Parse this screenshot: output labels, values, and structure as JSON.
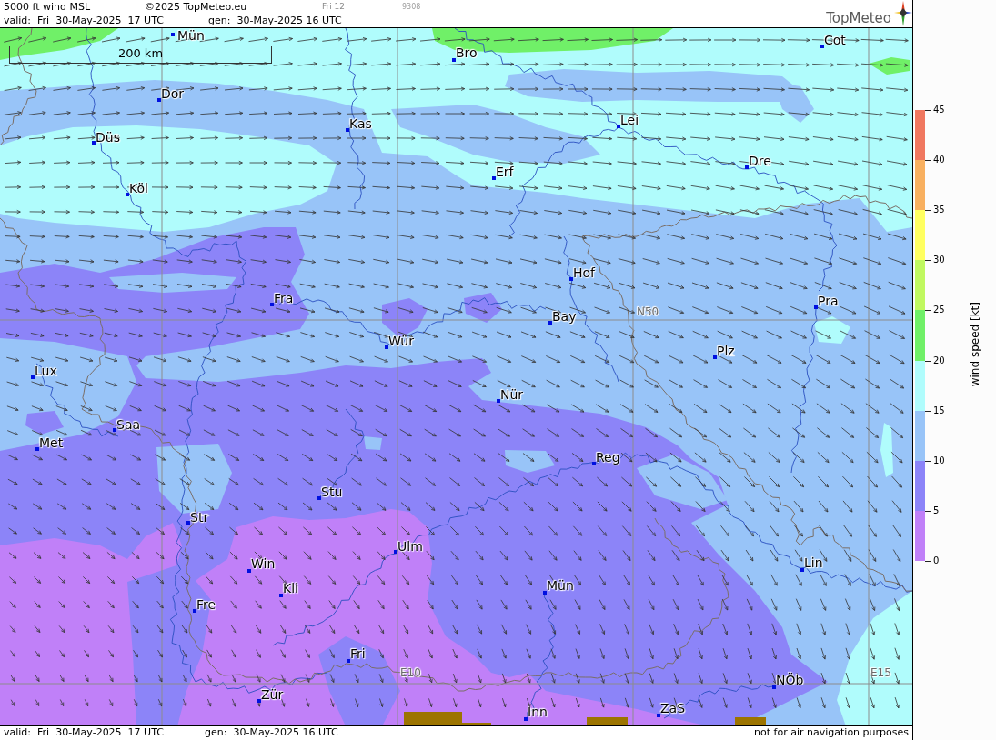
{
  "header": {
    "title": "5000 ft wind MSL",
    "copyright": "©2025 TopMeteo.eu",
    "frame": "Fri 12",
    "code": "9308",
    "valid": "valid:  Fri  30-May-2025  17 UTC",
    "generated": "gen:  30-May-2025 16 UTC",
    "logo": "TopMeteo"
  },
  "map": {
    "scale_bar": "200 km",
    "cities": [
      "Mün",
      "Bro",
      "Cot",
      "Dor",
      "Kas",
      "Lei",
      "Düs",
      "Erf",
      "Dre",
      "Köl",
      "Hof",
      "Fra",
      "Pra",
      "Bay",
      "Wür",
      "Plz",
      "Lux",
      "Nür",
      "Saa",
      "Met",
      "Reg",
      "Stu",
      "Str",
      "Ulm",
      "Win",
      "Lin",
      "Kli",
      "Mün",
      "Fre",
      "Fri",
      "NÖb",
      "Zür",
      "Inn",
      "ZaS"
    ],
    "grid_labels": [
      "N50",
      "E10",
      "E15"
    ]
  },
  "legend": {
    "title": "wind speed [kt]",
    "bands": [
      {
        "color": "#f07860"
      },
      {
        "color": "#f8b060"
      },
      {
        "color": "#ffff60"
      },
      {
        "color": "#c0f860"
      },
      {
        "color": "#70f068"
      },
      {
        "color": "#b0fcfc"
      },
      {
        "color": "#98c4f8"
      },
      {
        "color": "#8c84f8"
      },
      {
        "color": "#c080f8"
      }
    ],
    "ticks": [
      "45",
      "40",
      "35",
      "30",
      "25",
      "20",
      "15",
      "10",
      "5",
      "0"
    ]
  },
  "footer": {
    "valid": "valid:  Fri  30-May-2025  17 UTC",
    "generated": "gen:  30-May-2025 16 UTC",
    "disclaimer": "not for air navigation purposes"
  }
}
